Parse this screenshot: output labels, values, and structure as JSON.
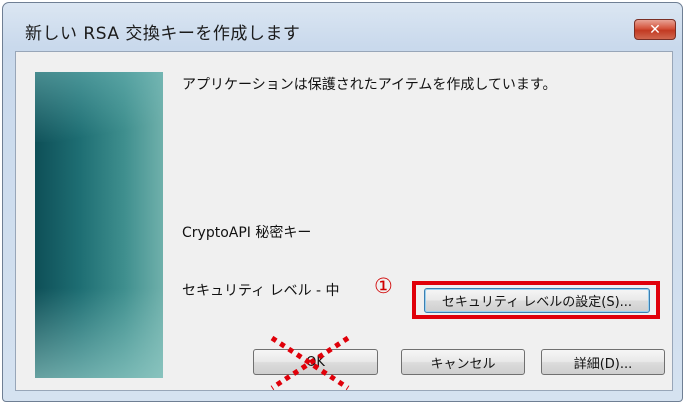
{
  "window": {
    "title": "新しい RSA 交換キーを作成します",
    "close_glyph": "✕"
  },
  "content": {
    "message": "アプリケーションは保護されたアイテムを作成しています。",
    "key_name": "CryptoAPI 秘密キー",
    "security_level": "セキュリティ レベル - 中"
  },
  "annotation": {
    "marker": "①",
    "highlight_color": "#e0000a"
  },
  "buttons": {
    "set_security": "セキュリティ レベルの設定(S)...",
    "ok": "OK",
    "cancel": "キャンセル",
    "details": "詳細(D)..."
  }
}
